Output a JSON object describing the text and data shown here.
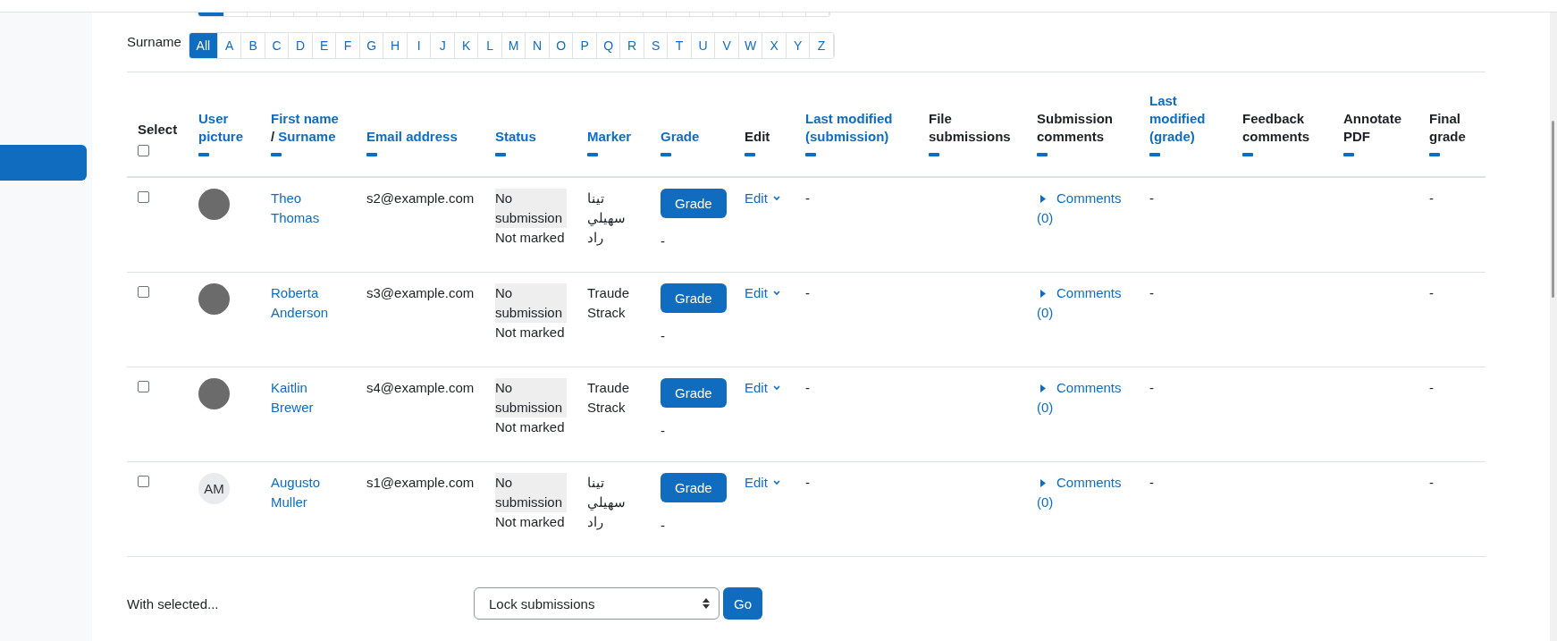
{
  "surname_filter": {
    "label": "Surname",
    "letters": [
      {
        "text": "All",
        "selected": true
      },
      {
        "text": "A",
        "selected": false
      },
      {
        "text": "B",
        "selected": false
      },
      {
        "text": "C",
        "selected": false
      },
      {
        "text": "D",
        "selected": false
      },
      {
        "text": "E",
        "selected": false
      },
      {
        "text": "F",
        "selected": false
      },
      {
        "text": "G",
        "selected": false
      },
      {
        "text": "H",
        "selected": false
      },
      {
        "text": "I",
        "selected": false
      },
      {
        "text": "J",
        "selected": false
      },
      {
        "text": "K",
        "selected": false
      },
      {
        "text": "L",
        "selected": false
      },
      {
        "text": "M",
        "selected": false
      },
      {
        "text": "N",
        "selected": false
      },
      {
        "text": "O",
        "selected": false
      },
      {
        "text": "P",
        "selected": false
      },
      {
        "text": "Q",
        "selected": false
      },
      {
        "text": "R",
        "selected": false
      },
      {
        "text": "S",
        "selected": false
      },
      {
        "text": "T",
        "selected": false
      },
      {
        "text": "U",
        "selected": false
      },
      {
        "text": "V",
        "selected": false
      },
      {
        "text": "W",
        "selected": false
      },
      {
        "text": "X",
        "selected": false
      },
      {
        "text": "Y",
        "selected": false
      },
      {
        "text": "Z",
        "selected": false
      }
    ]
  },
  "table": {
    "columns": [
      {
        "kind": "select",
        "label": "Select",
        "checked": false
      },
      {
        "kind": "link",
        "label": "User picture"
      },
      {
        "kind": "split",
        "parts": [
          "First name",
          "Surname"
        ],
        "separator": "/"
      },
      {
        "kind": "link",
        "label": "Email address"
      },
      {
        "kind": "link",
        "label": "Status"
      },
      {
        "kind": "link",
        "label": "Marker"
      },
      {
        "kind": "link",
        "label": "Grade"
      },
      {
        "kind": "plain",
        "label": "Edit"
      },
      {
        "kind": "link",
        "label": "Last modified (submission)"
      },
      {
        "kind": "plain",
        "label": "File submissions"
      },
      {
        "kind": "plain",
        "label": "Submission comments"
      },
      {
        "kind": "link",
        "label": "Last modified (grade)"
      },
      {
        "kind": "plain",
        "label": "Feedback comments"
      },
      {
        "kind": "plain",
        "label": "Annotate PDF"
      },
      {
        "kind": "plain",
        "label": "Final grade"
      }
    ],
    "rows": [
      {
        "checked": false,
        "avatar": {
          "kind": "photo"
        },
        "name": "Theo Thomas",
        "email": "s2@example.com",
        "status": "No submission",
        "grading_status": "Not marked",
        "marker": "تینا سهیلي راد",
        "grade_button": "Grade",
        "grade": "-",
        "edit": "Edit",
        "last_modified_submission": "-",
        "comments": "Comments (0)",
        "last_modified_grade": "-",
        "final_grade": "-"
      },
      {
        "checked": false,
        "avatar": {
          "kind": "photo"
        },
        "name": "Roberta Anderson",
        "email": "s3@example.com",
        "status": "No submission",
        "grading_status": "Not marked",
        "marker": "Traude Strack",
        "grade_button": "Grade",
        "grade": "-",
        "edit": "Edit",
        "last_modified_submission": "-",
        "comments": "Comments (0)",
        "last_modified_grade": "-",
        "final_grade": "-"
      },
      {
        "checked": false,
        "avatar": {
          "kind": "photo"
        },
        "name": "Kaitlin Brewer",
        "email": "s4@example.com",
        "status": "No submission",
        "grading_status": "Not marked",
        "marker": "Traude Strack",
        "grade_button": "Grade",
        "grade": "-",
        "edit": "Edit",
        "last_modified_submission": "-",
        "comments": "Comments (0)",
        "last_modified_grade": "-",
        "final_grade": "-"
      },
      {
        "checked": false,
        "avatar": {
          "kind": "initials",
          "text": "AM"
        },
        "name": "Augusto Muller",
        "email": "s1@example.com",
        "status": "No submission",
        "grading_status": "Not marked",
        "marker": "تینا سهیلي راد",
        "grade_button": "Grade",
        "grade": "-",
        "edit": "Edit",
        "last_modified_submission": "-",
        "comments": "Comments (0)",
        "last_modified_grade": "-",
        "final_grade": "-"
      }
    ]
  },
  "bulk": {
    "label": "With selected...",
    "action": "Lock submissions",
    "button": "Go"
  }
}
